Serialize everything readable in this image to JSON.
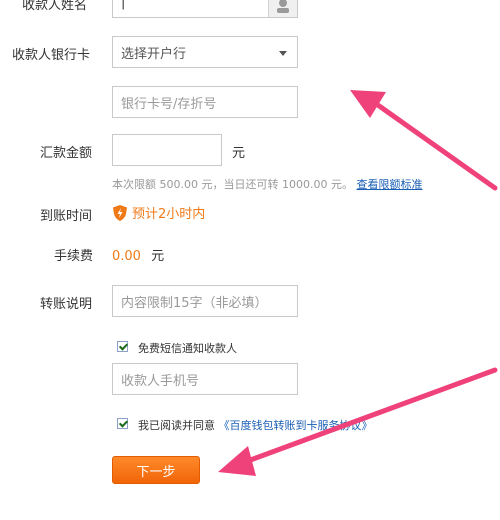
{
  "form": {
    "payee_name_label": "收款人姓名",
    "payee_name_value": "|",
    "bank_card_label": "收款人银行卡",
    "bank_select_value": "选择开户行",
    "card_number_placeholder": "银行卡号/存折号",
    "amount_label": "汇款金额",
    "amount_unit": "元",
    "limit_hint": "本次限额 500.00 元，当日还可转 1000.00 元。",
    "limit_link": "查看限额标准",
    "arrival_label": "到账时间",
    "arrival_value": "预计2小时内",
    "fee_label": "手续费",
    "fee_value": "0.00",
    "fee_unit": "元",
    "note_label": "转账说明",
    "note_placeholder": "内容限制15字（非必填）",
    "sms_label": "免费短信通知收款人",
    "sms_checked": true,
    "phone_placeholder": "收款人手机号",
    "agree_text": "我已阅读并同意",
    "agree_link": "《百度钱包转账到卡服务协议》",
    "agree_checked": true,
    "next_button": "下一步"
  },
  "colors": {
    "accent": "#f07a17",
    "link": "#1a5fb4",
    "arrow": "#f0427a"
  }
}
